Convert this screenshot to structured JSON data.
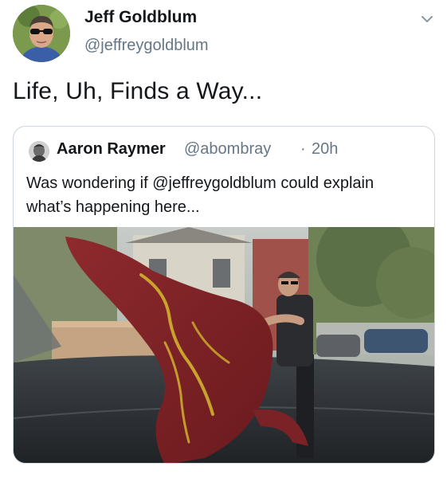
{
  "tweet": {
    "author_name": "Jeff Goldblum",
    "author_handle": "@jeffreygoldblum",
    "text": "Life, Uh, Finds a Way...",
    "menu_icon": "chevron-down-icon"
  },
  "quoted_tweet": {
    "author_name": "Aaron Raymer",
    "author_handle": "@abombray",
    "separator": "·",
    "time": "20h",
    "text": "Was wondering if @jeffreygoldblum could explain what’s happening here...",
    "photo_icon": "photo"
  },
  "colors": {
    "primary_text": "#14171a",
    "secondary_text": "#657786",
    "border": "#ccd6dd"
  }
}
